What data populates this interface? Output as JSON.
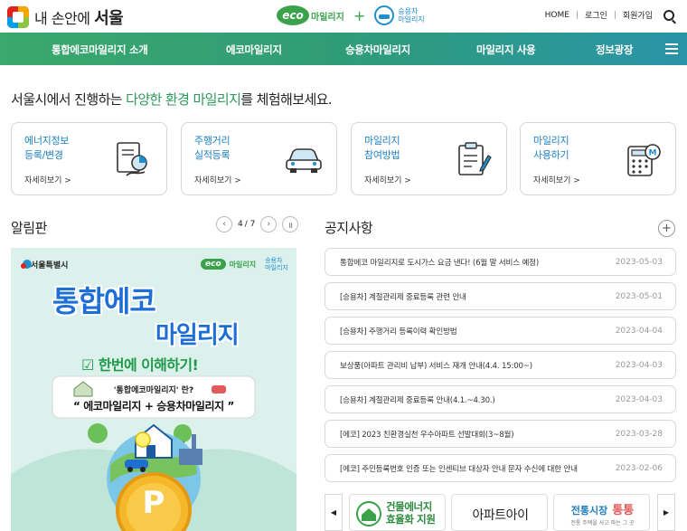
{
  "header": {
    "brand_prefix": "내 손안에",
    "brand_city": "서울",
    "eco_logo_text": "eco",
    "eco_logo_sub": "마일리지",
    "car_logo_sub_1": "승용차",
    "car_logo_sub_2": "마일리지",
    "car_logo_en": "mileage",
    "links": [
      "HOME",
      "로그인",
      "회원가입"
    ]
  },
  "nav": {
    "items": [
      "통합에코마일리지 소개",
      "에코마일리지",
      "승용차마일리지",
      "마일리지 사용",
      "정보광장"
    ]
  },
  "intro": {
    "prefix": "서울시에서 진행하는 ",
    "highlight": "다양한 환경 마일리지",
    "suffix": "를 체험해보세요."
  },
  "cards": [
    {
      "line1": "에너지정보",
      "line2": "등록/변경",
      "link": "자세히보기 >",
      "icon": "document-chart-icon"
    },
    {
      "line1": "주행거리",
      "line2": "실적등록",
      "link": "자세히보기 >",
      "icon": "car-icon"
    },
    {
      "line1": "마일리지",
      "line2": "참여방법",
      "link": "자세히보기 >",
      "icon": "clipboard-icon"
    },
    {
      "line1": "마일리지",
      "line2": "사용하기",
      "link": "자세히보기 >",
      "icon": "calculator-icon"
    }
  ],
  "alerts": {
    "title": "알림판",
    "page_current": "4",
    "page_total": "/ 7",
    "banner": {
      "org": "서울특별시",
      "eco_logo_text": "eco",
      "eco_logo_sub": "마일리지",
      "car_logo_sub_1": "승용차",
      "car_logo_sub_2": "마일리지",
      "headline_1": "통합에코",
      "headline_2": "마일리지",
      "subhead": "한번에 이해하기!",
      "box_line1": "'통합에코마일리지' 란?",
      "box_line2": "“ 에코마일리지 + 승용차마일리지 ”",
      "coin_letter": "P"
    }
  },
  "notices": {
    "title": "공지사항",
    "items": [
      {
        "text": "통합에코 마일리지로 도시가스 요금 낸다! (6월 말 서비스 예정)",
        "date": "2023-05-03"
      },
      {
        "text": "[승용차] 계절관리제 중료등록 관련 안내",
        "date": "2023-05-01"
      },
      {
        "text": "[승용차] 주행거리 등록이력 확인방법",
        "date": "2023-04-04"
      },
      {
        "text": "보상품(아파트 관리비 납부) 서비스 재개 안내(4.4. 15:00~)",
        "date": "2023-04-03"
      },
      {
        "text": "[승용차] 계절관리제 중료등록 안내(4.1.~4.30.)",
        "date": "2023-04-03"
      },
      {
        "text": "[에코] 2023 친환경실천 우수아파트 선발대회(3~8월)",
        "date": "2023-03-28"
      },
      {
        "text": "[에코] 주민등록번호 인증 또는 인센티브 대상자 안내 문자 수신에 대한 안내",
        "date": "2023-02-06"
      }
    ]
  },
  "partners": {
    "prev": "◀",
    "next": "▶",
    "items": [
      {
        "line1": "건물에너지",
        "line2": "효율화 지원"
      },
      {
        "line1": "아파트아이"
      },
      {
        "line1": "전통시장",
        "line2": "통통",
        "line3": "전통 주택을 사고 파는 그 곳"
      }
    ]
  },
  "colors": {
    "green": "#2d9a5b",
    "blue": "#1e7fc0",
    "nav_start": "#3aa96b",
    "nav_end": "#2a94a8"
  }
}
